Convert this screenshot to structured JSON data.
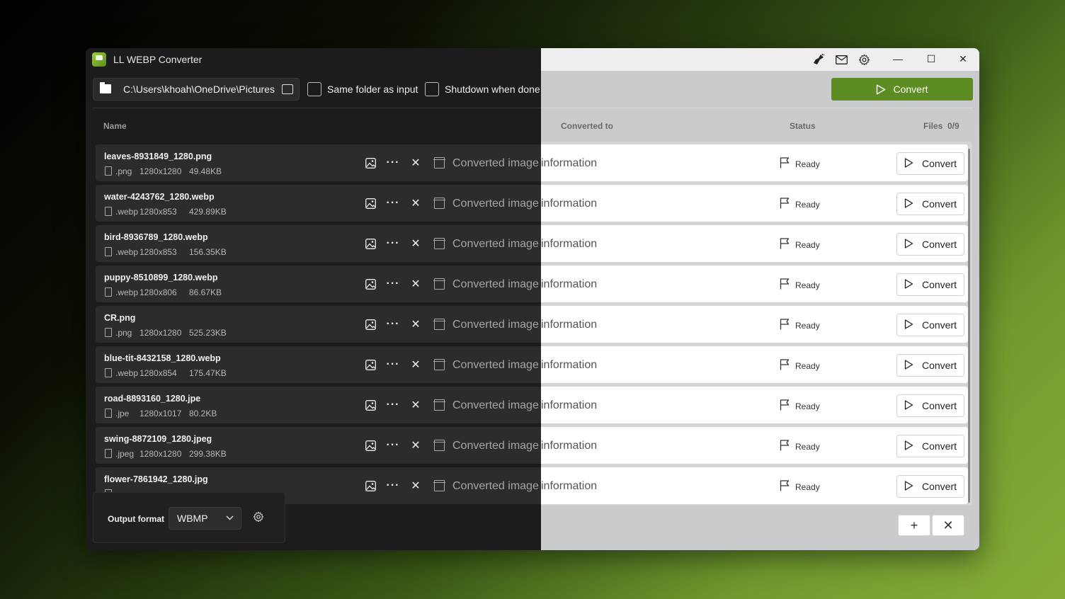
{
  "app": {
    "title": "LL WEBP Converter",
    "accent": "#5d8c23"
  },
  "titlebar": {
    "icons": [
      "broom-icon",
      "mail-icon",
      "gear-icon"
    ],
    "minimize": "—",
    "maximize": "☐",
    "close": "✕"
  },
  "toolbar": {
    "output_path": "C:\\Users\\khoah\\OneDrive\\Pictures",
    "same_folder_label": "Same folder as input",
    "same_folder_checked": false,
    "shutdown_label": "Shutdown when done",
    "shutdown_checked": false,
    "convert_label": "Convert"
  },
  "columns": {
    "name": "Name",
    "converted_to": "Converted to",
    "status": "Status",
    "files_label": "Files",
    "files_count": "0/9"
  },
  "files": [
    {
      "name": "leaves-8931849_1280.png",
      "ext": ".png",
      "dims": "1280x1280",
      "size": "49.48KB",
      "info": "Converted image information",
      "status": "Ready",
      "action": "Convert"
    },
    {
      "name": "water-4243762_1280.webp",
      "ext": ".webp",
      "dims": "1280x853",
      "size": "429.89KB",
      "info": "Converted image information",
      "status": "Ready",
      "action": "Convert"
    },
    {
      "name": "bird-8936789_1280.webp",
      "ext": ".webp",
      "dims": "1280x853",
      "size": "156.35KB",
      "info": "Converted image information",
      "status": "Ready",
      "action": "Convert"
    },
    {
      "name": "puppy-8510899_1280.webp",
      "ext": ".webp",
      "dims": "1280x806",
      "size": "86.67KB",
      "info": "Converted image information",
      "status": "Ready",
      "action": "Convert"
    },
    {
      "name": "CR.png",
      "ext": ".png",
      "dims": "1280x1280",
      "size": "525.23KB",
      "info": "Converted image information",
      "status": "Ready",
      "action": "Convert"
    },
    {
      "name": "blue-tit-8432158_1280.webp",
      "ext": ".webp",
      "dims": "1280x854",
      "size": "175.47KB",
      "info": "Converted image information",
      "status": "Ready",
      "action": "Convert"
    },
    {
      "name": "road-8893160_1280.jpe",
      "ext": ".jpe",
      "dims": "1280x1017",
      "size": "80.2KB",
      "info": "Converted image information",
      "status": "Ready",
      "action": "Convert"
    },
    {
      "name": "swing-8872109_1280.jpeg",
      "ext": ".jpeg",
      "dims": "1280x1280",
      "size": "299.38KB",
      "info": "Converted image information",
      "status": "Ready",
      "action": "Convert"
    },
    {
      "name": "flower-7861942_1280.jpg",
      "ext": "",
      "dims": "",
      "size": "",
      "info": "Converted image information",
      "status": "Ready",
      "action": "Convert"
    }
  ],
  "bottom": {
    "output_format_label": "Output format",
    "output_format_value": "WBMP",
    "add_button": "+",
    "clear_button": "✕"
  }
}
